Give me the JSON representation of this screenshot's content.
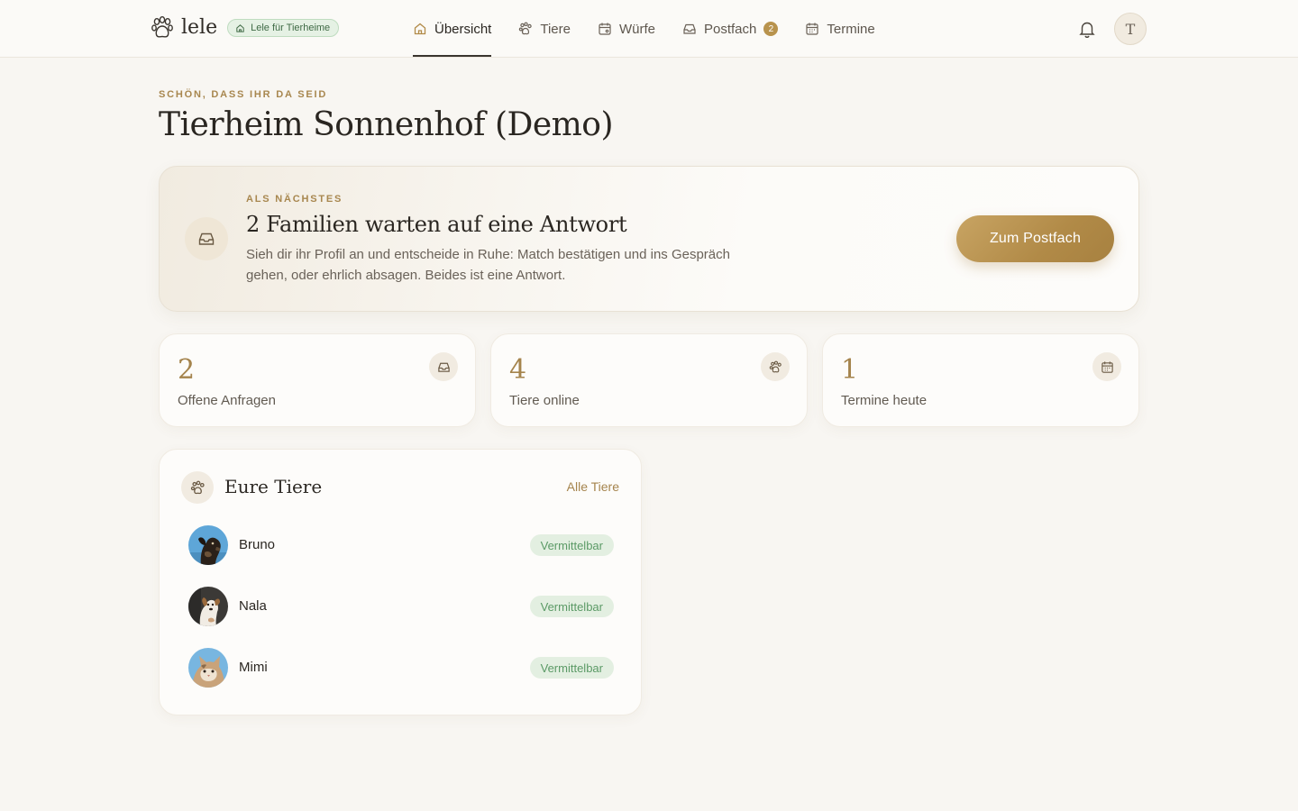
{
  "brand": {
    "name": "lele",
    "badge": "Lele für Tierheime"
  },
  "nav": [
    {
      "label": "Übersicht",
      "icon": "home-icon",
      "active": true
    },
    {
      "label": "Tiere",
      "icon": "paw-icon"
    },
    {
      "label": "Würfe",
      "icon": "calendar-icon"
    },
    {
      "label": "Postfach",
      "icon": "inbox-icon",
      "badge": "2"
    },
    {
      "label": "Termine",
      "icon": "calendar-icon"
    }
  ],
  "header": {
    "avatar_initial": "T",
    "bell_icon": "bell-icon"
  },
  "greeting": {
    "eyebrow": "SCHÖN, DASS IHR DA SEID",
    "title": "Tierheim Sonnenhof (Demo)"
  },
  "next": {
    "eyebrow": "ALS NÄCHSTES",
    "title": "2 Familien warten auf eine Antwort",
    "text": "Sieh dir ihr Profil an und entscheide in Ruhe: Match bestätigen und ins Gespräch gehen, oder ehrlich absagen. Beides ist eine Antwort.",
    "button": "Zum Postfach",
    "icon": "inbox-icon"
  },
  "stats": [
    {
      "value": "2",
      "label": "Offene Anfragen",
      "icon": "inbox-icon"
    },
    {
      "value": "4",
      "label": "Tiere online",
      "icon": "paw-icon"
    },
    {
      "value": "1",
      "label": "Termine heute",
      "icon": "calendar-icon"
    }
  ],
  "animals": {
    "title": "Eure Tiere",
    "link": "Alle Tiere",
    "items": [
      {
        "name": "Bruno",
        "status": "Vermittelbar"
      },
      {
        "name": "Nala",
        "status": "Vermittelbar"
      },
      {
        "name": "Mimi",
        "status": "Vermittelbar"
      }
    ]
  },
  "colors": {
    "accent": "#b18a47",
    "background": "#f8f6f2",
    "status_green": "#5b9a66"
  }
}
